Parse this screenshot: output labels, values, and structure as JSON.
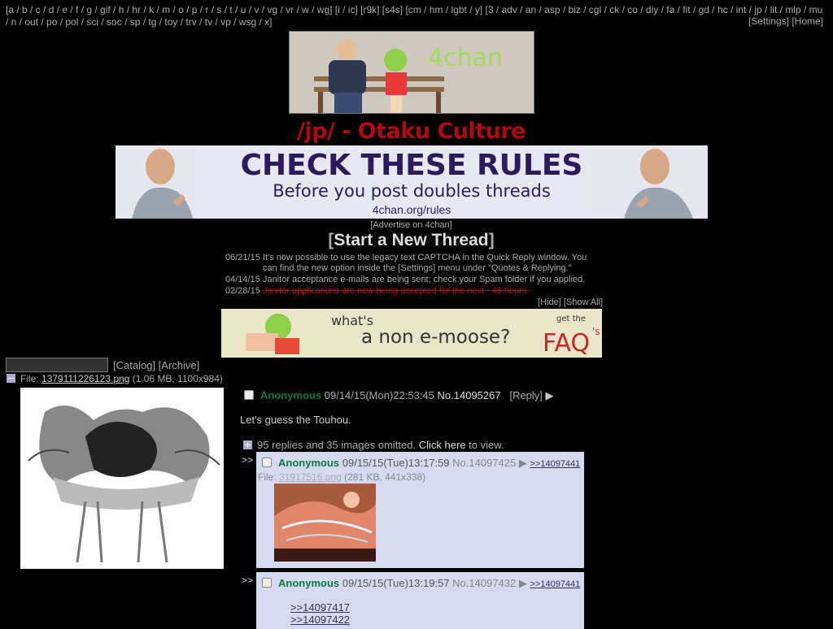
{
  "nav": {
    "boards": "[a / b / c / d / e / f / g / gif / h / hr / k / m / o / p / r / s / t / u / v / vg / vr / w / wg] [i / ic] [r9k] [s4s] [cm / hm / lgbt / y] [3 / adv / an / asp / biz / cgl / ck / co / diy / fa / fit / gd / hc / int / jp / lit / mlp / mu / n / out / po / pol / sci / soc / sp / tg / toy / trv / tv / vp / wsg / x]",
    "settings": "[Settings]",
    "home": "[Home]"
  },
  "banner": {
    "text": "4chan"
  },
  "board_title": "/jp/ - Otaku Culture",
  "ad": {
    "headline": "CHECK THESE RULES",
    "subline": "Before you post doubles threads",
    "url": "4chan.org/rules"
  },
  "advertise": "[Advertise on 4chan]",
  "start_thread": {
    "open": "[",
    "label": "Start a New Thread",
    "close": "]"
  },
  "news": [
    {
      "date": "06/21/15",
      "text": "It's now possible to use the legacy text CAPTCHA in the Quick Reply window. You can find the new option inside the [Settings] menu under \"Quotes & Replying.\""
    },
    {
      "date": "04/14/15",
      "text": "Janitor acceptance e-mails are being sent; check your Spam folder if you applied."
    },
    {
      "date": "02/28/15",
      "text": "Janitor applications are now being accepted for the next ~48 hours."
    }
  ],
  "news_controls": {
    "hide": "[Hide]",
    "show_all": "[Show All]"
  },
  "faq_banner": {
    "line1": "what's",
    "line2": "a non e-moose?",
    "small": "get the",
    "big": "FAQ",
    "s": "'s"
  },
  "catalog": "[Catalog]",
  "archive": "[Archive]",
  "op": {
    "file_label": "File:",
    "file_name": "1379111226123.png",
    "file_meta": "(1.06 MB, 1100x984)",
    "name": "Anonymous",
    "datetime": "09/14/15(Mon)22:53:45",
    "no": "No.14095267",
    "reply": "[Reply]",
    "message": "Let's guess the Touhou.",
    "omitted_prefix": "95 replies and 35 images omitted.",
    "omitted_link": "Click here",
    "omitted_suffix": "to view."
  },
  "replies": [
    {
      "prefix": ">>",
      "name": "Anonymous",
      "datetime": "09/15/15(Tue)13:17:59",
      "no": "No.14097425",
      "backlink": ">>14097441",
      "file_label": "File:",
      "file_name": "31917516.png",
      "file_meta": "(281 KB, 441x338)"
    },
    {
      "prefix": ">>",
      "name": "Anonymous",
      "datetime": "09/15/15(Tue)13:19:57",
      "no": "No.14097432",
      "backlink": ">>14097441",
      "quotes": [
        ">>14097417",
        ">>14097422"
      ]
    }
  ]
}
